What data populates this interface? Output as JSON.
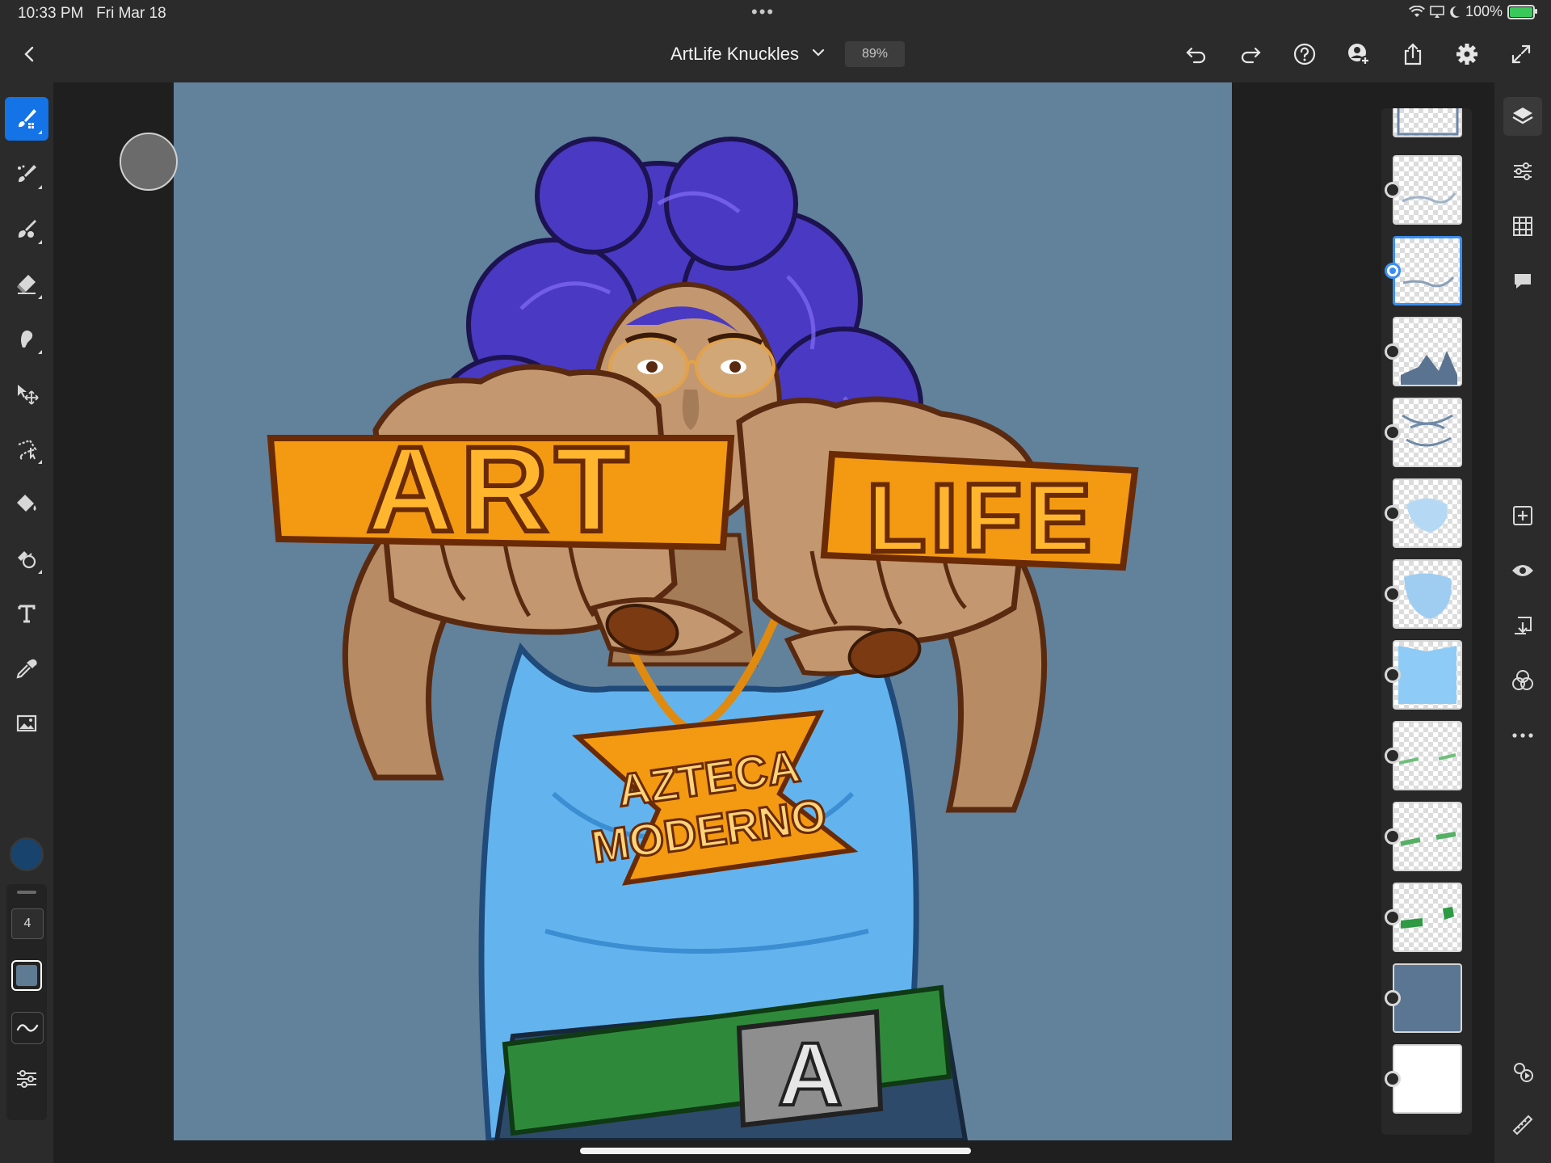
{
  "status": {
    "time": "10:33 PM",
    "date": "Fri Mar 18",
    "battery": "100%",
    "dots": "•••"
  },
  "header": {
    "title": "ArtLife Knuckles",
    "zoom": "89%"
  },
  "toolbar": {
    "left_icons": [
      "brush-tool-icon",
      "pixel-brush-icon",
      "mixer-brush-icon",
      "eraser-icon",
      "smudge-icon",
      "move-icon",
      "lasso-icon",
      "paint-bucket-icon",
      "clone-stamp-icon",
      "type-icon",
      "eyedropper-icon",
      "image-place-icon"
    ],
    "brush_size": "4",
    "opacity_color": "#5f7a93",
    "foreground_color": "#17436d"
  },
  "top_icons": [
    "undo-icon",
    "redo-icon",
    "help-icon",
    "invite-icon",
    "share-icon",
    "settings-icon",
    "fullscreen-icon"
  ],
  "right_icons": [
    "layers-icon",
    "adjustments-icon",
    "grid-icon",
    "comments-icon",
    "add-layer-icon",
    "visibility-icon",
    "merge-down-icon",
    "blend-modes-icon",
    "more-icon",
    "history-icon",
    "ruler-icon"
  ],
  "layers": {
    "count": 13,
    "selected_index": 2
  },
  "artwork": {
    "headline_left": "ART",
    "headline_right": "LIFE",
    "shirt_line1": "AZTECA",
    "shirt_line2": "MODERNO",
    "buckle": "A",
    "colors": {
      "background": "#62819b",
      "hair": "#4a39c2",
      "skin": "#c39870",
      "lettering": "#f39a12",
      "shirt": "#63b4ee",
      "belt": "#2e8a3a"
    }
  }
}
